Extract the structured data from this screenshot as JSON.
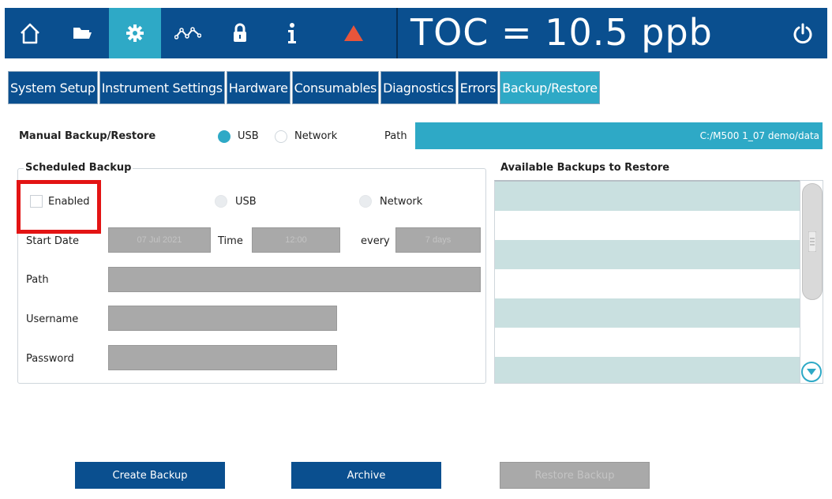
{
  "nav": {
    "icons": [
      "home-icon",
      "folder-icon",
      "gear-icon",
      "trend-icon",
      "lock-icon",
      "info-icon",
      "alarm-icon",
      "power-icon"
    ],
    "reading": "TOC = 10.5 ppb"
  },
  "tabs": [
    "System Setup",
    "Instrument Settings",
    "Hardware",
    "Consumables",
    "Diagnostics",
    "Errors",
    "Backup/Restore"
  ],
  "manual": {
    "title": "Manual Backup/Restore",
    "usb_label": "USB",
    "network_label": "Network",
    "path_label": "Path",
    "path_value": "C:/M500 1_07 demo/data"
  },
  "scheduled": {
    "title": "Scheduled Backup",
    "enabled_label": "Enabled",
    "usb_label": "USB",
    "network_label": "Network",
    "start_date_label": "Start Date",
    "start_date_value": "07 Jul 2021",
    "time_label": "Time",
    "time_value": "12:00",
    "every_label": "every",
    "every_value": "7 days",
    "path_label": "Path",
    "username_label": "Username",
    "password_label": "Password"
  },
  "available": {
    "title": "Available Backups to Restore"
  },
  "buttons": {
    "create": "Create Backup",
    "archive": "Archive",
    "restore": "Restore Backup"
  },
  "colors": {
    "brand_blue": "#0a4f8f",
    "accent_teal": "#2ea9c6",
    "highlight_red": "#e31414"
  }
}
